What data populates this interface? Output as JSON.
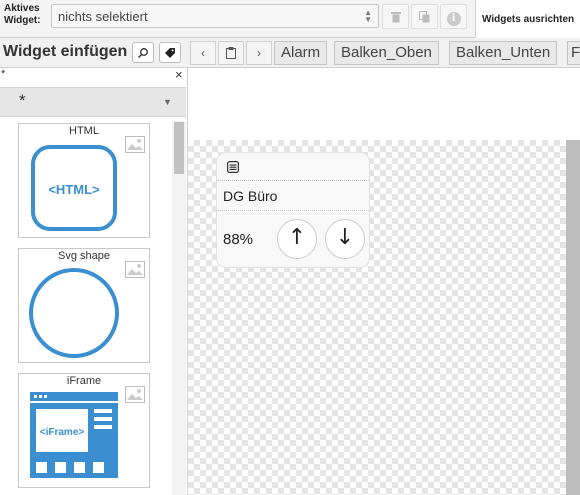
{
  "toolbar": {
    "active_widget_label_line1": "Aktives",
    "active_widget_label_line2": "Widget:",
    "active_widget_value": "nichts selektiert",
    "align_widgets_label": "Widgets ausrichten"
  },
  "widget_panel": {
    "title": "Widget einfügen",
    "header_mark": "*",
    "close_glyph": "×",
    "filter_value": "*",
    "items": [
      {
        "label": "HTML",
        "preview_text": "<HTML>"
      },
      {
        "label": "Svg shape"
      },
      {
        "label": "iFrame",
        "preview_text": "<iFrame>"
      }
    ]
  },
  "view_tabs": [
    "Alarm",
    "Balken_Oben",
    "Balken_Unten",
    "F"
  ],
  "canvas_widget": {
    "title": "DG Büro",
    "value": "88%",
    "up_glyph": "↑",
    "down_glyph": "↓"
  },
  "colors": {
    "accent_blue": "#3b8fd1",
    "toolbar_bg": "#f3f3f3"
  }
}
